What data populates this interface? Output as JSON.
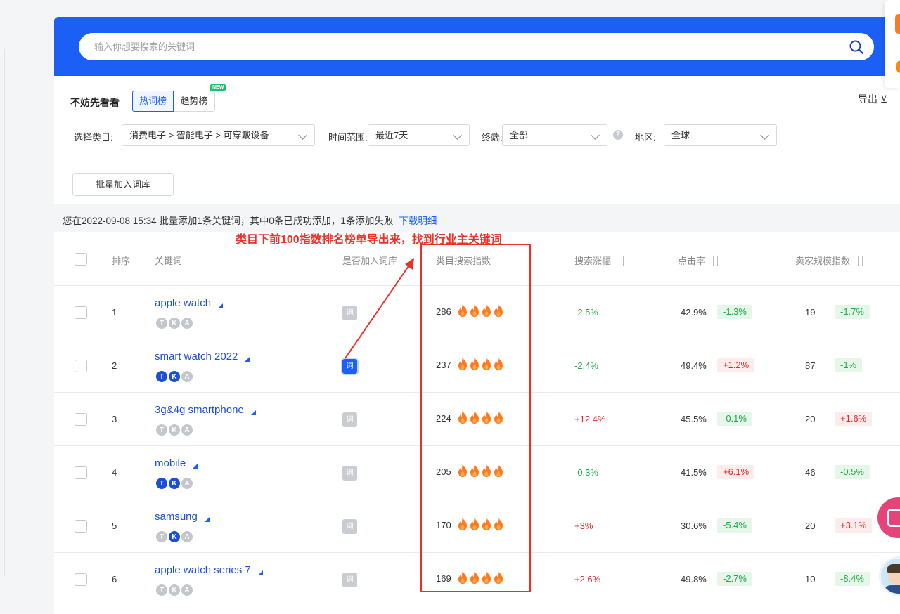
{
  "search": {
    "placeholder": "输入你想要搜索的关键词"
  },
  "suggest": {
    "label": "不妨先看看",
    "tabs": [
      "热词榜",
      "趋势榜"
    ],
    "new_badge": "NEW"
  },
  "export_label": "导出 ⊻",
  "filters": {
    "category_label": "选择类目:",
    "category_value": "消费电子 > 智能电子 > 可穿戴设备",
    "time_label": "时间范围:",
    "time_value": "最近7天",
    "terminal_label": "终端:",
    "terminal_value": "全部",
    "region_label": "地区:",
    "region_value": "全球"
  },
  "batch_button": "批量加入词库",
  "notice": {
    "text": "您在2022-09-08 15:34 批量添加1条关键词，其中0条已成功添加，1条添加失败",
    "link": "下载明细"
  },
  "annotation": "类目下前100指数排名榜单导出来，找到行业主关键词",
  "table": {
    "headers": {
      "rank": "排序",
      "keyword": "关键词",
      "in_library": "是否加入词库",
      "category_index": "类目搜索指数",
      "search_change": "搜索涨幅",
      "ctr": "点击率",
      "seller_index": "卖家规模指数"
    },
    "word_icon": "词",
    "badge_letters": [
      "T",
      "K",
      "A"
    ],
    "rows": [
      {
        "rank": "1",
        "keyword": "apple watch",
        "badges_on": [
          false,
          false,
          false
        ],
        "in_library": false,
        "index": "286",
        "change": "-2.5%",
        "change_dir": "down",
        "ctr": "42.9%",
        "ctr_change": "-1.3%",
        "ctr_dir": "down",
        "seller": "19",
        "seller_change": "-1.7%",
        "seller_dir": "down"
      },
      {
        "rank": "2",
        "keyword": "smart watch 2022",
        "badges_on": [
          true,
          true,
          false
        ],
        "in_library": true,
        "index": "237",
        "change": "-2.4%",
        "change_dir": "down",
        "ctr": "49.4%",
        "ctr_change": "+1.2%",
        "ctr_dir": "up",
        "seller": "87",
        "seller_change": "-1%",
        "seller_dir": "down"
      },
      {
        "rank": "3",
        "keyword": "3g&4g smartphone",
        "badges_on": [
          false,
          false,
          false
        ],
        "in_library": false,
        "index": "224",
        "change": "+12.4%",
        "change_dir": "up",
        "ctr": "45.5%",
        "ctr_change": "-0.1%",
        "ctr_dir": "down",
        "seller": "20",
        "seller_change": "+1.6%",
        "seller_dir": "up"
      },
      {
        "rank": "4",
        "keyword": "mobile",
        "badges_on": [
          true,
          true,
          false
        ],
        "in_library": false,
        "index": "205",
        "change": "-0.3%",
        "change_dir": "down",
        "ctr": "41.5%",
        "ctr_change": "+6.1%",
        "ctr_dir": "up",
        "seller": "46",
        "seller_change": "-0.5%",
        "seller_dir": "down"
      },
      {
        "rank": "5",
        "keyword": "samsung",
        "badges_on": [
          false,
          true,
          false
        ],
        "in_library": false,
        "index": "170",
        "change": "+3%",
        "change_dir": "up",
        "ctr": "30.6%",
        "ctr_change": "-5.4%",
        "ctr_dir": "down",
        "seller": "20",
        "seller_change": "+3.1%",
        "seller_dir": "up"
      },
      {
        "rank": "6",
        "keyword": "apple watch series 7",
        "badges_on": [
          false,
          false,
          false
        ],
        "in_library": false,
        "index": "169",
        "change": "+2.6%",
        "change_dir": "up",
        "ctr": "49.8%",
        "ctr_change": "-2.7%",
        "ctr_dir": "down",
        "seller": "10",
        "seller_change": "-8.4%",
        "seller_dir": "down"
      }
    ]
  },
  "colors": {
    "primary": "#1b5ff5",
    "up": "#e02b2b",
    "down": "#1faa4c",
    "flame": "#ff7a1a",
    "annotation": "#ee2f28"
  }
}
